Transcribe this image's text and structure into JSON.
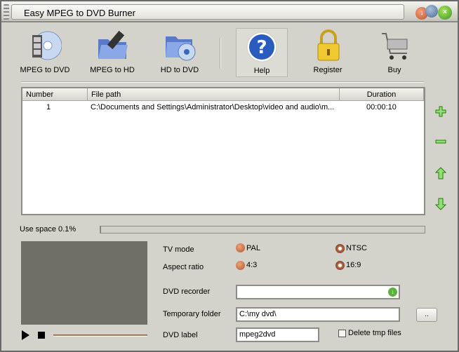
{
  "window": {
    "title": "Easy MPEG to DVD Burner"
  },
  "toolbar": {
    "mpeg_to_dvd": "MPEG to DVD",
    "mpeg_to_hd": "MPEG to HD",
    "hd_to_dvd": "HD to DVD",
    "help": "Help",
    "register": "Register",
    "buy": "Buy"
  },
  "file_list": {
    "columns": [
      "Number",
      "File path",
      "Duration"
    ],
    "rows": [
      {
        "number": "1",
        "path": "C:\\Documents and Settings\\Administrator\\Desktop\\video and audio\\m...",
        "duration": "00:00:10"
      }
    ]
  },
  "usage": {
    "label": "Use space 0.1%",
    "percent": 0.1
  },
  "settings": {
    "tv_mode_label": "TV mode",
    "pal": "PAL",
    "ntsc": "NTSC",
    "tv_mode_selected": "NTSC",
    "aspect_label": "Aspect ratio",
    "ar43": "4:3",
    "ar169": "16:9",
    "aspect_selected": "16:9",
    "dvd_recorder_label": "DVD recorder",
    "dvd_recorder_value": "",
    "temp_folder_label": "Temporary folder",
    "temp_folder_value": "C:\\my dvd\\",
    "browse_label": "..",
    "dvd_label_label": "DVD label",
    "dvd_label_value": "mpeg2dvd",
    "delete_tmp_label": "Delete tmp files",
    "delete_tmp_checked": false
  },
  "colors": {
    "accent_green": "#4caa2c",
    "radio": "#c0663a",
    "preview_bg": "#6f6f66"
  }
}
